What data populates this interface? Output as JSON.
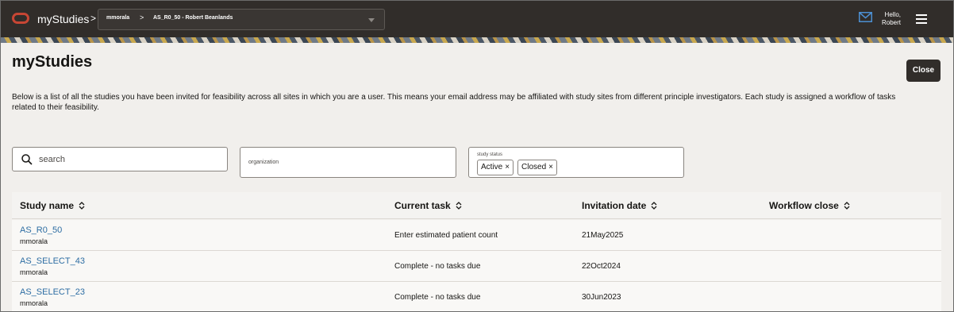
{
  "header": {
    "app_title": "myStudies",
    "breadcrumb_sep": ">",
    "breadcrumb_user": "mmorala",
    "breadcrumb_study": "AS_R0_50 - Robert Beanlands",
    "greeting_line1": "Hello,",
    "greeting_line2": "Robert",
    "icons": [
      "oracle-logo",
      "mail-icon",
      "hamburger-menu-icon",
      "chevron-down-icon"
    ]
  },
  "page": {
    "title": "myStudies",
    "close_label": "Close",
    "intro": "Below is a list of all the studies you have been invited for feasibility across all sites in which you are a user. This means your email address may be affiliated with study sites from different principle investigators. Each study is assigned a workflow of tasks related to their feasibility."
  },
  "filters": {
    "search_placeholder": "search",
    "organization_placeholder": "organization",
    "status_label": "study status",
    "status_chips": [
      "Active",
      "Closed"
    ],
    "chip_remove": "×"
  },
  "table": {
    "columns": [
      "Study name",
      "Current task",
      "Invitation date",
      "Workflow close"
    ],
    "rows": [
      {
        "study": "AS_R0_50",
        "owner": "mmorala",
        "task": "Enter estimated patient count",
        "date": "21May2025",
        "close": ""
      },
      {
        "study": "AS_SELECT_43",
        "owner": "mmorala",
        "task": "Complete - no tasks due",
        "date": "22Oct2024",
        "close": ""
      },
      {
        "study": "AS_SELECT_23",
        "owner": "mmorala",
        "task": "Complete - no tasks due",
        "date": "30Jun2023",
        "close": ""
      }
    ]
  },
  "colors": {
    "header_bg": "#312d2a",
    "oracle_red": "#c74634",
    "link": "#2d6da3",
    "mail_blue": "#4c8fd1"
  }
}
